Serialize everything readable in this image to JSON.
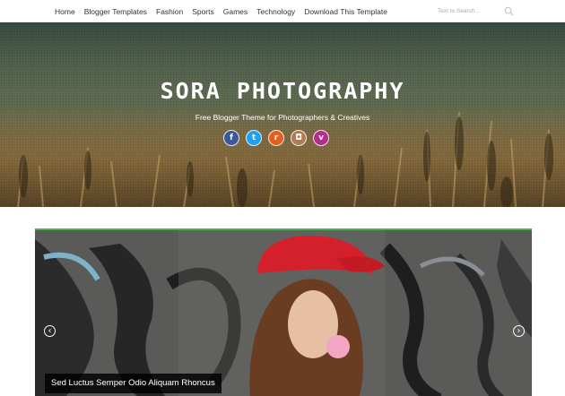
{
  "nav": {
    "items": [
      {
        "label": "Home"
      },
      {
        "label": "Blogger Templates"
      },
      {
        "label": "Fashion"
      },
      {
        "label": "Sports"
      },
      {
        "label": "Games"
      },
      {
        "label": "Technology"
      },
      {
        "label": "Download This Template"
      }
    ],
    "search": {
      "placeholder": "Text to Search...",
      "icon": "search-icon"
    }
  },
  "header": {
    "title": "SORA PHOTOGRAPHY",
    "tagline": "Free Blogger Theme for Photographers & Creatives",
    "social": [
      {
        "icon": "facebook-icon",
        "glyph": "f",
        "color": "#3b5998"
      },
      {
        "icon": "twitter-icon",
        "glyph": "t",
        "color": "#1da1f2"
      },
      {
        "icon": "rss-icon",
        "glyph": "r",
        "color": "#e25f1f"
      },
      {
        "icon": "instagram-icon",
        "glyph": "◘",
        "color": "#b07a56"
      },
      {
        "icon": "vimeo-icon",
        "glyph": "v",
        "color": "#b42d8a"
      }
    ]
  },
  "slider": {
    "caption": "Sed Luctus Semper Odio Aliquam Rhoncus",
    "accent_color": "#4caf50",
    "prev_icon": "circle-arrow-left-icon",
    "next_icon": "circle-arrow-right-icon"
  }
}
